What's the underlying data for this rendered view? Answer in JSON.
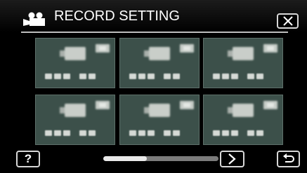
{
  "header": {
    "title": "RECORD SETTING",
    "icon": "video-camera-icon"
  },
  "close_button": {
    "icon": "close-icon"
  },
  "grid": {
    "tiles": [
      {
        "label": "setting-tile-1"
      },
      {
        "label": "setting-tile-2"
      },
      {
        "label": "setting-tile-3"
      },
      {
        "label": "setting-tile-4"
      },
      {
        "label": "setting-tile-5"
      },
      {
        "label": "setting-tile-6"
      }
    ]
  },
  "footer": {
    "help_label": "?",
    "next_icon": "chevron-right-icon",
    "back_icon": "return-arrow-icon",
    "scroll_position": 0.38
  },
  "colors": {
    "background": "#000000",
    "tile": "#3c504a",
    "button_border": "#d8d8d8",
    "scroll_track": "#7b7b7b",
    "scroll_thumb": "#e9e9e9"
  }
}
